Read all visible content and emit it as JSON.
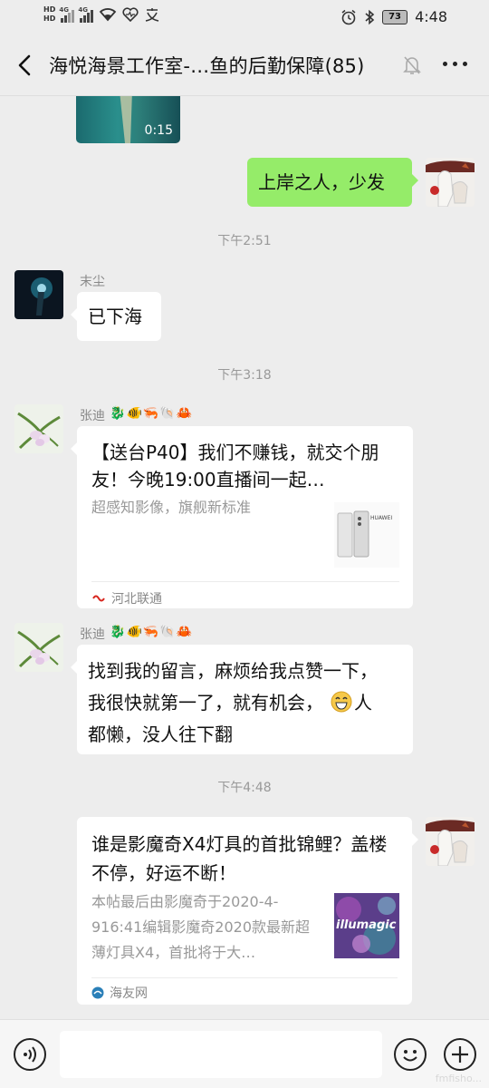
{
  "status_bar": {
    "hd_top": "HD",
    "hd_bottom": "HD",
    "net1": "4G",
    "net2": "4G",
    "battery": "73",
    "time": "4:48"
  },
  "header": {
    "title": "海悦海景工作室-…鱼的后勤保障(85)"
  },
  "messages": {
    "video": {
      "duration": "0:15"
    },
    "m1": {
      "text": "上岸之人，少发"
    },
    "t1": "下午2:51",
    "m2": {
      "sender": "末尘",
      "text": "已下海"
    },
    "t2": "下午3:18",
    "m3": {
      "sender": "张迪",
      "title": "【送台P40】我们不赚钱，就交个朋友！今晚19:00直播间一起…",
      "desc": "超感知影像，旗舰新标准",
      "thumb_brand": "HUAWEI",
      "source": "河北联通"
    },
    "m4": {
      "sender": "张迪",
      "line1": "找到我的留言，麻烦给我点赞一下，",
      "line2": "我很快就第一了，就有机会，",
      "line2b": "人",
      "line3": "都懒，没人往下翻"
    },
    "t3": "下午4:48",
    "m5": {
      "title": "谁是影魔奇X4灯具的首批锦鲤？盖楼不停，好运不断！",
      "desc": "本帖最后由影魔奇于2020-4-916:41编辑影魔奇2020款最新超薄灯具X4，首批将于大…",
      "thumb_text": "illumagic",
      "source": "海友网"
    }
  },
  "input_bar": {
    "placeholder": ""
  },
  "watermark": "fmfisho..."
}
